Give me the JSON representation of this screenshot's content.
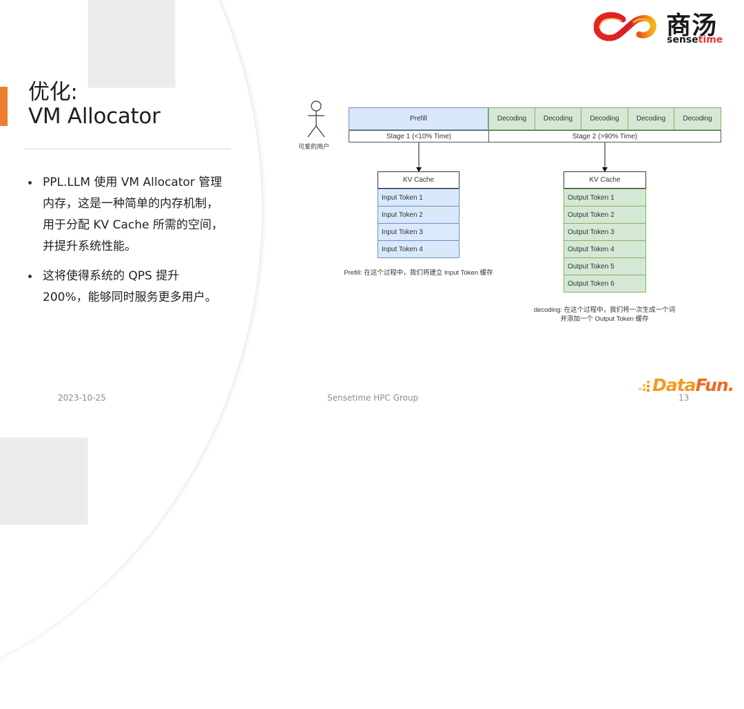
{
  "slide": {
    "title_line1": "优化:",
    "title_line2": "VM Allocator",
    "bullets": [
      "PPL.LLM 使用 VM Allocator 管理内存，这是一种简单的内存机制，用于分配 KV Cache 所需的空间，并提升系统性能。",
      "这将使得系统的 QPS 提升 200%，能够同时服务更多用户。"
    ],
    "accent_color": "#ed7d31"
  },
  "logo": {
    "cn": "商汤",
    "en_prefix": "sense",
    "en_suffix": "time"
  },
  "diagram": {
    "user_label": "可爱的用户",
    "prefill_label": "Prefill",
    "decoding_labels": [
      "Decoding",
      "Decoding",
      "Decoding",
      "Decoding",
      "Decoding"
    ],
    "stage1": "Stage 1 (<10% Time)",
    "stage2": "Stage 2 (>90% Time)",
    "kv_left": {
      "header": "KV Cache",
      "rows": [
        "Input Token 1",
        "Input Token 2",
        "Input Token 3",
        "Input Token 4"
      ],
      "caption": "Prefill: 在这个过程中，我们将建立 Input Token 缓存"
    },
    "kv_right": {
      "header": "KV Cache",
      "rows": [
        "Output Token 1",
        "Output Token 2",
        "Output Token 3",
        "Output Token 4",
        "Output Token 5",
        "Output Token 6"
      ],
      "caption_line1": "decoding: 在这个过程中，我们将一次生成一个词",
      "caption_line2": "并添加一个 Output Token 缓存"
    },
    "colors": {
      "prefill_fill": "#dae8fc",
      "decoding_fill": "#d5e8d4"
    }
  },
  "footer": {
    "date": "2023-10-25",
    "center": "Sensetime HPC Group",
    "page": "13",
    "brand_a": "Data",
    "brand_b": "Fun."
  }
}
